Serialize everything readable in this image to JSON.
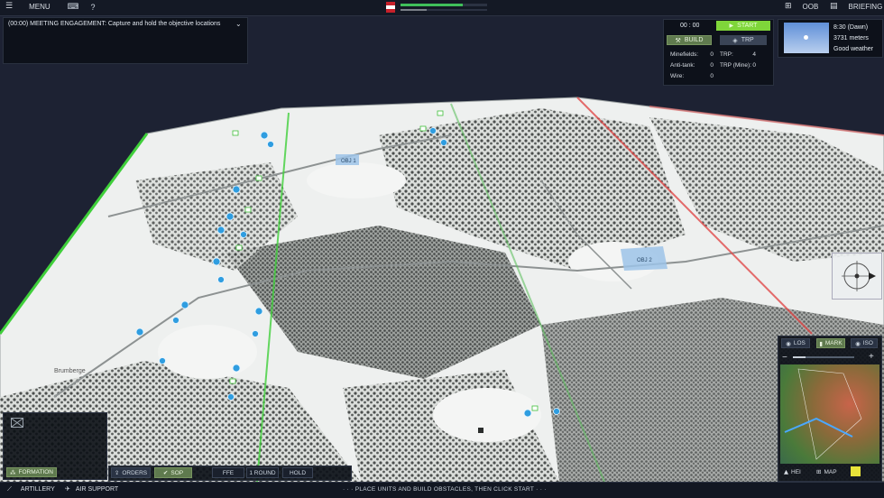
{
  "topbar": {
    "menu_label": "MENU",
    "help_label": "?",
    "oob_label": "OOB",
    "briefing_label": "BRIEFING",
    "flag_red": "#c8202a",
    "strength_color": "#3fbf5a"
  },
  "mission": {
    "text": "(00:00) MEETING ENGAGEMENT: Capture and hold the objective locations"
  },
  "deployment": {
    "timer": "00 : 00",
    "start_label": "START",
    "build_label": "BUILD",
    "trp_label": "TRP",
    "rows": [
      {
        "label": "Minefields:",
        "value": "0"
      },
      {
        "label": "Anti-tank:",
        "value": "0"
      },
      {
        "label": "Wire:",
        "value": "0"
      }
    ],
    "trp_rows": [
      {
        "label": "TRP:",
        "value": "4"
      },
      {
        "label": "TRP (Mine):",
        "value": "0"
      }
    ]
  },
  "weather": {
    "time": "8:30 (Dawn)",
    "visibility": "3731 meters",
    "condition": "Good weather"
  },
  "map": {
    "objectives": [
      "OBJ 1",
      "OBJ 2"
    ],
    "town_label": "Brumberge",
    "friendly_color": "#2f9de0",
    "friendly_border_color": "#3fcf3a",
    "enemy_border_color": "#e04848"
  },
  "minimap": {
    "los_label": "LOS",
    "mark_label": "MARK",
    "iso_label": "ISO",
    "zoom_out": "−",
    "zoom_in": "+",
    "hei_label": "HEI",
    "map_label": "MAP"
  },
  "unit_panel": {
    "formation_label": "FORMATION"
  },
  "commands": {
    "orders_label": "ORDERS",
    "sop_label": "SOP",
    "ffe_label": "FFE",
    "round_label": "1 ROUND",
    "hold_label": "HOLD"
  },
  "bottombar": {
    "artillery_label": "ARTILLERY",
    "air_support_label": "AIR SUPPORT",
    "hint": "· · ·  PLACE UNITS AND BUILD OBSTACLES, THEN CLICK START  · · ·"
  }
}
